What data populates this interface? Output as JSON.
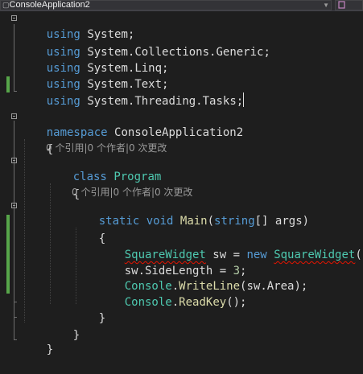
{
  "navbar": {
    "project": "ConsoleApplication2"
  },
  "code": {
    "using1": "using",
    "ns1": "System;",
    "using2": "using",
    "ns2": "System.Collections.Generic;",
    "using3": "using",
    "ns3": "System.Linq;",
    "using4": "using",
    "ns4": "System.Text;",
    "using5": "using",
    "ns5": "System.Threading.Tasks;",
    "namespace_kw": "namespace",
    "namespace_name": "ConsoleApplication2",
    "open_brace": "{",
    "close_brace": "}",
    "lens_class": "0 个引用|0 个作者|0 次更改",
    "class_kw": "class",
    "class_name": "Program",
    "lens_method": "0 个引用|0 个作者|0 次更改",
    "static_kw": "static",
    "void_kw": "void",
    "method_name": "Main",
    "paren_open": "(",
    "string_kw": "string",
    "params_rest": "[] args)",
    "type_widget": "SquareWidget",
    "var_sw": " sw = ",
    "new_kw": "new",
    "ctor_widget": "SquareWidget",
    "ctor_end": "();",
    "assign_line": "sw.SideLength = ",
    "assign_val": "3",
    "semicolon": ";",
    "console1": "Console",
    "dot": ".",
    "writeline": "WriteLine",
    "writeline_args": "(sw.Area);",
    "console2": "Console",
    "readkey": "ReadKey",
    "readkey_args": "();"
  },
  "colors": {
    "background": "#1e1e1e",
    "keyword": "#569cd6",
    "type": "#4ec9b0",
    "method": "#dcdcaa",
    "plain": "#dcdcdc",
    "codelens": "#999999",
    "change_bar": "#57a64a",
    "error_squiggle": "#e51400"
  }
}
